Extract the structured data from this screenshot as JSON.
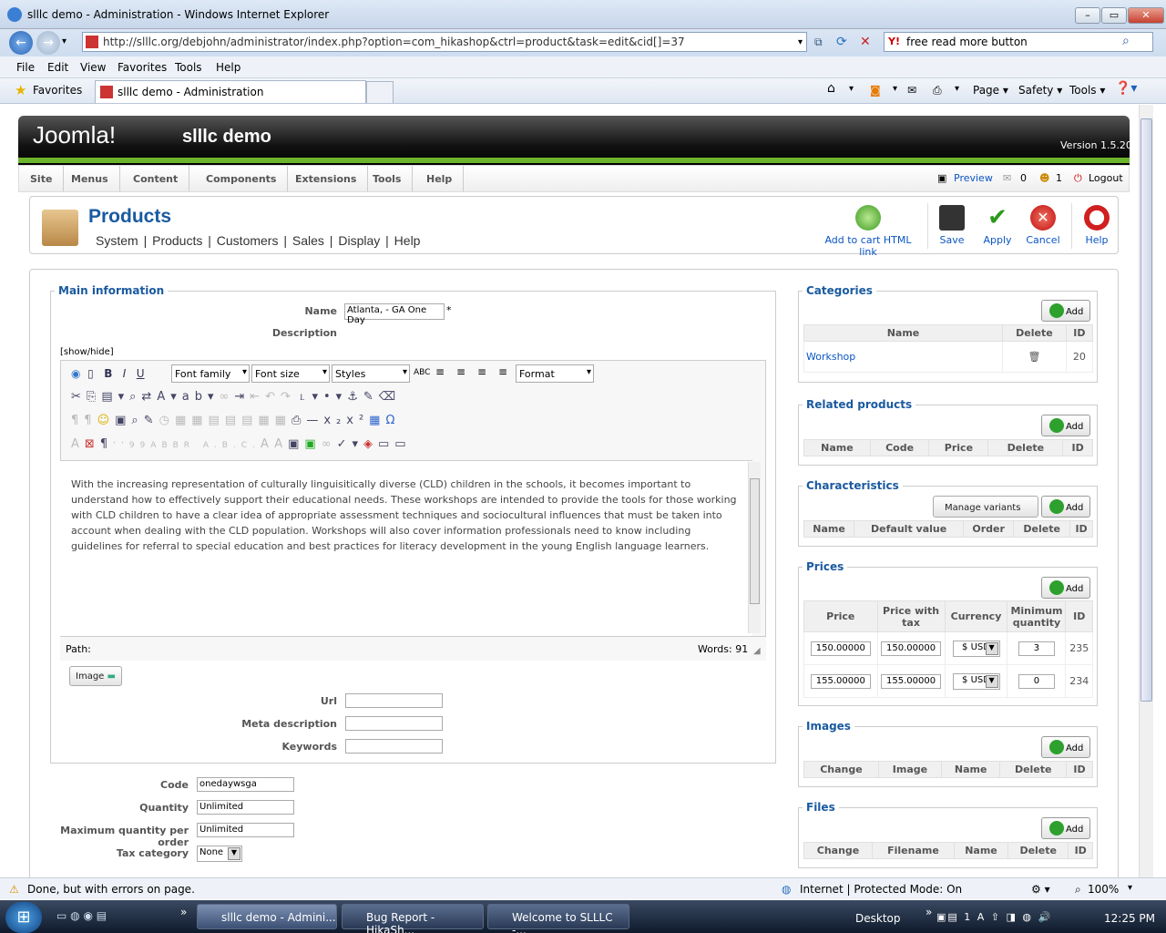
{
  "browser": {
    "title": "slllc demo - Administration - Windows Internet Explorer",
    "url": "http://slllc.org/debjohn/administrator/index.php?option=com_hikashop&ctrl=product&task=edit&cid[]=37",
    "search_value": "free read more button",
    "menu": [
      "File",
      "Edit",
      "View",
      "Favorites",
      "Tools",
      "Help"
    ],
    "favorites_label": "Favorites",
    "tab_title": "slllc demo - Administration",
    "commands": [
      "Page",
      "Safety",
      "Tools"
    ],
    "status_text": "Done, but with errors on page.",
    "zone_text": "Internet | Protected Mode: On",
    "zoom": "100%"
  },
  "joomla": {
    "logo": "Joomla!",
    "site_name": "slllc demo",
    "version": "Version 1.5.20",
    "menu": [
      "Site",
      "Menus",
      "Content",
      "Components",
      "Extensions",
      "Tools",
      "Help"
    ],
    "preview": "Preview",
    "messages_count": "0",
    "users_count": "1",
    "logout": "Logout"
  },
  "page": {
    "title": "Products",
    "submenu": [
      "System",
      "Products",
      "Customers",
      "Sales",
      "Display",
      "Help"
    ],
    "toolbar": {
      "add_cart": "Add to cart HTML link",
      "save": "Save",
      "apply": "Apply",
      "cancel": "Cancel",
      "help": "Help"
    }
  },
  "main_info": {
    "legend": "Main information",
    "name_label": "Name",
    "name_value": "Atlanta, - GA One Day",
    "required_mark": "*",
    "description_label": "Description",
    "show_hide": "[show/hide]",
    "editor_selects": {
      "font_family": "Font family",
      "font_size": "Font size",
      "styles": "Styles",
      "format": "Format"
    },
    "editor_text": "With the increasing representation of culturally linguisitically diverse (CLD) children in the schools, it becomes important to understand how to effectively support their educational needs. These workshops are intended to provide the tools for those working with CLD children to have a clear idea of appropriate assessment techniques and sociocultural influences that must be taken into account when dealing with the CLD population. Workshops will also cover information professionals need to know including guidelines for referral to special education and best practices for literacy development in the young English language learners.",
    "path_label": "Path:",
    "words": "Words: 91",
    "image_button": "Image",
    "url_label": "Url",
    "meta_label": "Meta description",
    "keywords_label": "Keywords"
  },
  "product_fields": {
    "code_label": "Code",
    "code_value": "onedaywsga",
    "quantity_label": "Quantity",
    "quantity_value": "Unlimited",
    "max_qty_label": "Maximum quantity per order",
    "max_qty_value": "Unlimited",
    "tax_label": "Tax category",
    "tax_value": "None"
  },
  "categories": {
    "legend": "Categories",
    "add": "Add",
    "headers": [
      "Name",
      "Delete",
      "ID"
    ],
    "rows": [
      {
        "name": "Workshop",
        "id": "20"
      }
    ]
  },
  "related": {
    "legend": "Related products",
    "add": "Add",
    "headers": [
      "Name",
      "Code",
      "Price",
      "Delete",
      "ID"
    ]
  },
  "characteristics": {
    "legend": "Characteristics",
    "manage": "Manage variants",
    "add": "Add",
    "headers": [
      "Name",
      "Default value",
      "Order",
      "Delete",
      "ID"
    ]
  },
  "prices": {
    "legend": "Prices",
    "add": "Add",
    "headers": [
      "Price",
      "Price with tax",
      "Currency",
      "Minimum quantity",
      "ID"
    ],
    "rows": [
      {
        "price": "150.00000",
        "price_tax": "150.00000",
        "currency": "$ USD",
        "min_qty": "3",
        "id": "235"
      },
      {
        "price": "155.00000",
        "price_tax": "155.00000",
        "currency": "$ USD",
        "min_qty": "0",
        "id": "234"
      }
    ]
  },
  "images": {
    "legend": "Images",
    "add": "Add",
    "headers": [
      "Change",
      "Image",
      "Name",
      "Delete",
      "ID"
    ]
  },
  "files": {
    "legend": "Files",
    "add": "Add",
    "headers": [
      "Change",
      "Filename",
      "Name",
      "Delete",
      "ID"
    ]
  },
  "taskbar": {
    "tasks": [
      "slllc demo - Admini...",
      "Bug Report - HikaSh...",
      "Welcome to SLLLC -..."
    ],
    "desktop": "Desktop",
    "clock": "12:25 PM"
  }
}
